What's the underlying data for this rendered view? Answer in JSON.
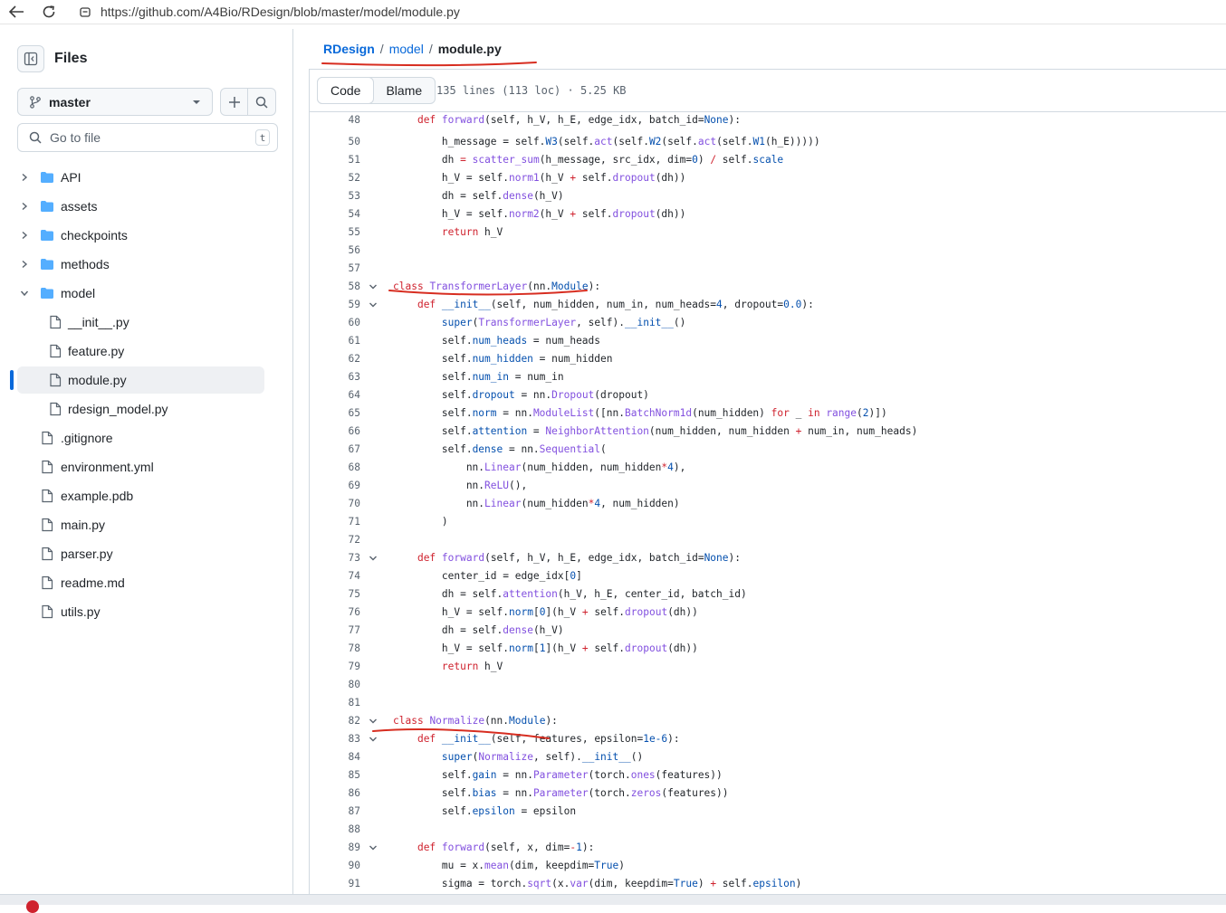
{
  "browser": {
    "url": "https://github.com/A4Bio/RDesign/blob/master/model/module.py"
  },
  "sidebar": {
    "title": "Files",
    "branch": "master",
    "goto_placeholder": "Go to file",
    "goto_shortcut": "t",
    "tree": [
      {
        "label": "API",
        "type": "folder",
        "expanded": false,
        "depth": 0
      },
      {
        "label": "assets",
        "type": "folder",
        "expanded": false,
        "depth": 0
      },
      {
        "label": "checkpoints",
        "type": "folder",
        "expanded": false,
        "depth": 0
      },
      {
        "label": "methods",
        "type": "folder",
        "expanded": false,
        "depth": 0
      },
      {
        "label": "model",
        "type": "folder",
        "expanded": true,
        "depth": 0
      },
      {
        "label": "__init__.py",
        "type": "file",
        "depth": 1
      },
      {
        "label": "feature.py",
        "type": "file",
        "depth": 1
      },
      {
        "label": "module.py",
        "type": "file",
        "depth": 1,
        "selected": true
      },
      {
        "label": "rdesign_model.py",
        "type": "file",
        "depth": 1
      },
      {
        "label": ".gitignore",
        "type": "file",
        "depth": 0
      },
      {
        "label": "environment.yml",
        "type": "file",
        "depth": 0
      },
      {
        "label": "example.pdb",
        "type": "file",
        "depth": 0
      },
      {
        "label": "main.py",
        "type": "file",
        "depth": 0
      },
      {
        "label": "parser.py",
        "type": "file",
        "depth": 0
      },
      {
        "label": "readme.md",
        "type": "file",
        "depth": 0
      },
      {
        "label": "utils.py",
        "type": "file",
        "depth": 0
      }
    ]
  },
  "breadcrumb": {
    "repo": "RDesign",
    "sep": "/",
    "folder": "model",
    "file": "module.py"
  },
  "toolbar": {
    "code_tab": "Code",
    "blame_tab": "Blame",
    "meta": "135 lines (113 loc) · 5.25 KB"
  },
  "code_lines": [
    {
      "n": "48",
      "fold": false,
      "tokens": [
        [
          "",
          "    "
        ],
        [
          "kw",
          "def"
        ],
        [
          "",
          " "
        ],
        [
          "fn",
          "forward"
        ],
        [
          "",
          "(self, h_V, h_E, edge_idx, batch_id="
        ],
        [
          "nm",
          "None"
        ],
        [
          "",
          "):"
        ]
      ]
    },
    {
      "n": "50",
      "fold": false,
      "tokens": [
        [
          "",
          "        h_message = self."
        ],
        [
          "at",
          "W3"
        ],
        [
          "",
          "(self."
        ],
        [
          "fn",
          "act"
        ],
        [
          "",
          "(self."
        ],
        [
          "at",
          "W2"
        ],
        [
          "",
          "(self."
        ],
        [
          "fn",
          "act"
        ],
        [
          "",
          "(self."
        ],
        [
          "at",
          "W1"
        ],
        [
          "",
          "(h_E)))))"
        ]
      ]
    },
    {
      "n": "51",
      "fold": false,
      "tokens": [
        [
          "",
          "        dh "
        ],
        [
          "kw",
          "="
        ],
        [
          "",
          " "
        ],
        [
          "fn",
          "scatter_sum"
        ],
        [
          "",
          "(h_message, src_idx, dim="
        ],
        [
          "nm",
          "0"
        ],
        [
          "",
          ") "
        ],
        [
          "kw",
          "/"
        ],
        [
          "",
          " self."
        ],
        [
          "at",
          "scale"
        ]
      ]
    },
    {
      "n": "52",
      "fold": false,
      "tokens": [
        [
          "",
          "        h_V = self."
        ],
        [
          "fn",
          "norm1"
        ],
        [
          "",
          "(h_V "
        ],
        [
          "kw",
          "+"
        ],
        [
          "",
          " self."
        ],
        [
          "fn",
          "dropout"
        ],
        [
          "",
          "(dh))"
        ]
      ]
    },
    {
      "n": "53",
      "fold": false,
      "tokens": [
        [
          "",
          "        dh = self."
        ],
        [
          "fn",
          "dense"
        ],
        [
          "",
          "(h_V)"
        ]
      ]
    },
    {
      "n": "54",
      "fold": false,
      "tokens": [
        [
          "",
          "        h_V = self."
        ],
        [
          "fn",
          "norm2"
        ],
        [
          "",
          "(h_V "
        ],
        [
          "kw",
          "+"
        ],
        [
          "",
          " self."
        ],
        [
          "fn",
          "dropout"
        ],
        [
          "",
          "(dh))"
        ]
      ]
    },
    {
      "n": "55",
      "fold": false,
      "tokens": [
        [
          "",
          "        "
        ],
        [
          "kw",
          "return"
        ],
        [
          "",
          " h_V"
        ]
      ]
    },
    {
      "n": "56",
      "fold": false,
      "tokens": []
    },
    {
      "n": "57",
      "fold": false,
      "tokens": []
    },
    {
      "n": "58",
      "fold": true,
      "tokens": [
        [
          "kw",
          "class"
        ],
        [
          "",
          " "
        ],
        [
          "fn",
          "TransformerLayer"
        ],
        [
          "",
          "(nn."
        ],
        [
          "at",
          "Module"
        ],
        [
          "",
          "):"
        ]
      ]
    },
    {
      "n": "59",
      "fold": true,
      "tokens": [
        [
          "",
          "    "
        ],
        [
          "kw",
          "def"
        ],
        [
          "",
          " "
        ],
        [
          "at",
          "__init__"
        ],
        [
          "",
          "(self, num_hidden, num_in, num_heads="
        ],
        [
          "nm",
          "4"
        ],
        [
          "",
          ", dropout="
        ],
        [
          "nm",
          "0.0"
        ],
        [
          "",
          "):"
        ]
      ]
    },
    {
      "n": "60",
      "fold": false,
      "tokens": [
        [
          "",
          "        "
        ],
        [
          "at",
          "super"
        ],
        [
          "",
          "("
        ],
        [
          "fn",
          "TransformerLayer"
        ],
        [
          "",
          ", self)."
        ],
        [
          "at",
          "__init__"
        ],
        [
          "",
          "()"
        ]
      ]
    },
    {
      "n": "61",
      "fold": false,
      "tokens": [
        [
          "",
          "        self."
        ],
        [
          "at",
          "num_heads"
        ],
        [
          "",
          " = num_heads"
        ]
      ]
    },
    {
      "n": "62",
      "fold": false,
      "tokens": [
        [
          "",
          "        self."
        ],
        [
          "at",
          "num_hidden"
        ],
        [
          "",
          " = num_hidden"
        ]
      ]
    },
    {
      "n": "63",
      "fold": false,
      "tokens": [
        [
          "",
          "        self."
        ],
        [
          "at",
          "num_in"
        ],
        [
          "",
          " = num_in"
        ]
      ]
    },
    {
      "n": "64",
      "fold": false,
      "tokens": [
        [
          "",
          "        self."
        ],
        [
          "at",
          "dropout"
        ],
        [
          "",
          " = nn."
        ],
        [
          "fn",
          "Dropout"
        ],
        [
          "",
          "(dropout)"
        ]
      ]
    },
    {
      "n": "65",
      "fold": false,
      "tokens": [
        [
          "",
          "        self."
        ],
        [
          "at",
          "norm"
        ],
        [
          "",
          " = nn."
        ],
        [
          "fn",
          "ModuleList"
        ],
        [
          "",
          "([nn."
        ],
        [
          "fn",
          "BatchNorm1d"
        ],
        [
          "",
          "(num_hidden) "
        ],
        [
          "kw",
          "for"
        ],
        [
          "",
          " _ "
        ],
        [
          "kw",
          "in"
        ],
        [
          "",
          " "
        ],
        [
          "fn",
          "range"
        ],
        [
          "",
          "("
        ],
        [
          "nm",
          "2"
        ],
        [
          "",
          ")])"
        ]
      ]
    },
    {
      "n": "66",
      "fold": false,
      "tokens": [
        [
          "",
          "        self."
        ],
        [
          "at",
          "attention"
        ],
        [
          "",
          " = "
        ],
        [
          "fn",
          "NeighborAttention"
        ],
        [
          "",
          "(num_hidden, num_hidden "
        ],
        [
          "kw",
          "+"
        ],
        [
          "",
          " num_in, num_heads)"
        ]
      ]
    },
    {
      "n": "67",
      "fold": false,
      "tokens": [
        [
          "",
          "        self."
        ],
        [
          "at",
          "dense"
        ],
        [
          "",
          " = nn."
        ],
        [
          "fn",
          "Sequential"
        ],
        [
          "",
          "("
        ]
      ]
    },
    {
      "n": "68",
      "fold": false,
      "tokens": [
        [
          "",
          "            nn."
        ],
        [
          "fn",
          "Linear"
        ],
        [
          "",
          "(num_hidden, num_hidden"
        ],
        [
          "kw",
          "*"
        ],
        [
          "nm",
          "4"
        ],
        [
          "",
          "),"
        ]
      ]
    },
    {
      "n": "69",
      "fold": false,
      "tokens": [
        [
          "",
          "            nn."
        ],
        [
          "fn",
          "ReLU"
        ],
        [
          "",
          "(),"
        ]
      ]
    },
    {
      "n": "70",
      "fold": false,
      "tokens": [
        [
          "",
          "            nn."
        ],
        [
          "fn",
          "Linear"
        ],
        [
          "",
          "(num_hidden"
        ],
        [
          "kw",
          "*"
        ],
        [
          "nm",
          "4"
        ],
        [
          "",
          ", num_hidden)"
        ]
      ]
    },
    {
      "n": "71",
      "fold": false,
      "tokens": [
        [
          "",
          "        )"
        ]
      ]
    },
    {
      "n": "72",
      "fold": false,
      "tokens": []
    },
    {
      "n": "73",
      "fold": true,
      "tokens": [
        [
          "",
          "    "
        ],
        [
          "kw",
          "def"
        ],
        [
          "",
          " "
        ],
        [
          "fn",
          "forward"
        ],
        [
          "",
          "(self, h_V, h_E, edge_idx, batch_id="
        ],
        [
          "nm",
          "None"
        ],
        [
          "",
          "):"
        ]
      ]
    },
    {
      "n": "74",
      "fold": false,
      "tokens": [
        [
          "",
          "        center_id = edge_idx["
        ],
        [
          "nm",
          "0"
        ],
        [
          "",
          "]"
        ]
      ]
    },
    {
      "n": "75",
      "fold": false,
      "tokens": [
        [
          "",
          "        dh = self."
        ],
        [
          "fn",
          "attention"
        ],
        [
          "",
          "(h_V, h_E, center_id, batch_id)"
        ]
      ]
    },
    {
      "n": "76",
      "fold": false,
      "tokens": [
        [
          "",
          "        h_V = self."
        ],
        [
          "at",
          "norm"
        ],
        [
          "",
          "["
        ],
        [
          "nm",
          "0"
        ],
        [
          "",
          "](h_V "
        ],
        [
          "kw",
          "+"
        ],
        [
          "",
          " self."
        ],
        [
          "fn",
          "dropout"
        ],
        [
          "",
          "(dh))"
        ]
      ]
    },
    {
      "n": "77",
      "fold": false,
      "tokens": [
        [
          "",
          "        dh = self."
        ],
        [
          "fn",
          "dense"
        ],
        [
          "",
          "(h_V)"
        ]
      ]
    },
    {
      "n": "78",
      "fold": false,
      "tokens": [
        [
          "",
          "        h_V = self."
        ],
        [
          "at",
          "norm"
        ],
        [
          "",
          "["
        ],
        [
          "nm",
          "1"
        ],
        [
          "",
          "](h_V "
        ],
        [
          "kw",
          "+"
        ],
        [
          "",
          " self."
        ],
        [
          "fn",
          "dropout"
        ],
        [
          "",
          "(dh))"
        ]
      ]
    },
    {
      "n": "79",
      "fold": false,
      "tokens": [
        [
          "",
          "        "
        ],
        [
          "kw",
          "return"
        ],
        [
          "",
          " h_V"
        ]
      ]
    },
    {
      "n": "80",
      "fold": false,
      "tokens": []
    },
    {
      "n": "81",
      "fold": false,
      "tokens": []
    },
    {
      "n": "82",
      "fold": true,
      "tokens": [
        [
          "kw",
          "class"
        ],
        [
          "",
          " "
        ],
        [
          "fn",
          "Normalize"
        ],
        [
          "",
          "(nn."
        ],
        [
          "at",
          "Module"
        ],
        [
          "",
          "):"
        ]
      ]
    },
    {
      "n": "83",
      "fold": true,
      "tokens": [
        [
          "",
          "    "
        ],
        [
          "kw",
          "def"
        ],
        [
          "",
          " "
        ],
        [
          "at",
          "__init__"
        ],
        [
          "",
          "(self, features, epsilon="
        ],
        [
          "nm",
          "1e-6"
        ],
        [
          "",
          "):"
        ]
      ]
    },
    {
      "n": "84",
      "fold": false,
      "tokens": [
        [
          "",
          "        "
        ],
        [
          "at",
          "super"
        ],
        [
          "",
          "("
        ],
        [
          "fn",
          "Normalize"
        ],
        [
          "",
          ", self)."
        ],
        [
          "at",
          "__init__"
        ],
        [
          "",
          "()"
        ]
      ]
    },
    {
      "n": "85",
      "fold": false,
      "tokens": [
        [
          "",
          "        self."
        ],
        [
          "at",
          "gain"
        ],
        [
          "",
          " = nn."
        ],
        [
          "fn",
          "Parameter"
        ],
        [
          "",
          "(torch."
        ],
        [
          "fn",
          "ones"
        ],
        [
          "",
          "(features))"
        ]
      ]
    },
    {
      "n": "86",
      "fold": false,
      "tokens": [
        [
          "",
          "        self."
        ],
        [
          "at",
          "bias"
        ],
        [
          "",
          " = nn."
        ],
        [
          "fn",
          "Parameter"
        ],
        [
          "",
          "(torch."
        ],
        [
          "fn",
          "zeros"
        ],
        [
          "",
          "(features))"
        ]
      ]
    },
    {
      "n": "87",
      "fold": false,
      "tokens": [
        [
          "",
          "        self."
        ],
        [
          "at",
          "epsilon"
        ],
        [
          "",
          " = epsilon"
        ]
      ]
    },
    {
      "n": "88",
      "fold": false,
      "tokens": []
    },
    {
      "n": "89",
      "fold": true,
      "tokens": [
        [
          "",
          "    "
        ],
        [
          "kw",
          "def"
        ],
        [
          "",
          " "
        ],
        [
          "fn",
          "forward"
        ],
        [
          "",
          "(self, x, dim="
        ],
        [
          "kw",
          "-"
        ],
        [
          "nm",
          "1"
        ],
        [
          "",
          "):"
        ]
      ]
    },
    {
      "n": "90",
      "fold": false,
      "tokens": [
        [
          "",
          "        mu = x."
        ],
        [
          "fn",
          "mean"
        ],
        [
          "",
          "(dim, keepdim="
        ],
        [
          "nm",
          "True"
        ],
        [
          "",
          ")"
        ]
      ]
    },
    {
      "n": "91",
      "fold": false,
      "tokens": [
        [
          "",
          "        sigma = torch."
        ],
        [
          "fn",
          "sqrt"
        ],
        [
          "",
          "(x."
        ],
        [
          "fn",
          "var"
        ],
        [
          "",
          "(dim, keepdim="
        ],
        [
          "nm",
          "True"
        ],
        [
          "",
          ") "
        ],
        [
          "kw",
          "+"
        ],
        [
          "",
          " self."
        ],
        [
          "at",
          "epsilon"
        ],
        [
          "",
          ")"
        ]
      ]
    }
  ],
  "colors": {
    "link": "#0969da",
    "keyword": "#cf222e",
    "function": "#8250df",
    "attribute": "#0550ae",
    "annotation": "#d72d20",
    "folder": "#54aeff"
  }
}
